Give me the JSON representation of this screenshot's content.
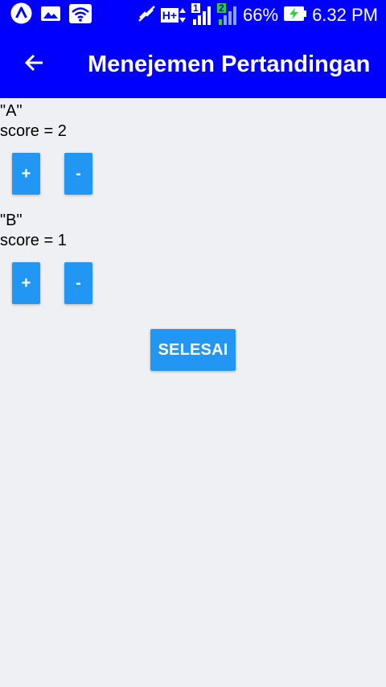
{
  "status_bar": {
    "battery_percent": "66%",
    "time": "6.32 PM",
    "network_type": "H+",
    "sim1_badge": "1",
    "sim2_badge": "2",
    "icons": [
      "app-a-icon",
      "gallery-icon",
      "wifi-icon",
      "muted-icon",
      "network-h-plus-icon",
      "signal-sim1-icon",
      "signal-sim2-icon",
      "battery-charging-icon"
    ]
  },
  "app_bar": {
    "title": "Menejemen Pertandingan",
    "back_icon": "arrow-left-icon"
  },
  "teams": [
    {
      "name": "\"A\"",
      "score_label": "score = 2",
      "score": 2,
      "plus_label": "+",
      "minus_label": "-"
    },
    {
      "name": "\"B\"",
      "score_label": "score = 1",
      "score": 1,
      "plus_label": "+",
      "minus_label": "-"
    }
  ],
  "finish_button": {
    "label": "SELESAI"
  },
  "colors": {
    "app_bar": "#0000ff",
    "button": "#2196f3",
    "background": "#eff0f4",
    "battery_bolt": "#2bd22b"
  }
}
